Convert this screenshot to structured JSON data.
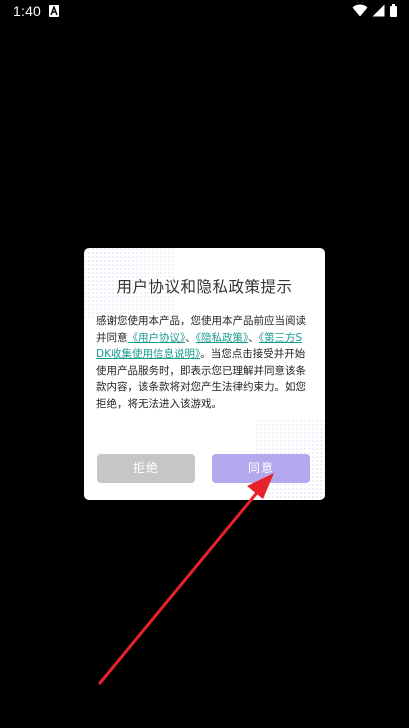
{
  "status_bar": {
    "time": "1:40"
  },
  "dialog": {
    "title": "用户协议和隐私政策提示",
    "body": {
      "intro": "感谢您使用本产品，您使用本产品前应当阅读并同意",
      "link_user_agreement": "《用户协议》",
      "sep1": "、",
      "link_privacy_policy": "《隐私政策》",
      "sep2": "、",
      "link_sdk_info": "《第三方SDK收集使用信息说明》",
      "outro": "。当您点击接受并开始使用产品服务时，即表示您已理解并同意该条款内容，该条款将对您产生法律约束力。如您拒绝，将无法进入该游戏。"
    },
    "refuse_label": "拒绝",
    "agree_label": "同意"
  },
  "colors": {
    "background": "#000000",
    "link": "#1a9b8f",
    "agree_button": "#b2a8ee",
    "refuse_button": "#c6c6c6",
    "arrow": "#e8222a"
  },
  "icons": [
    "a-app-icon",
    "wifi-icon",
    "signal-icon",
    "battery-icon"
  ]
}
